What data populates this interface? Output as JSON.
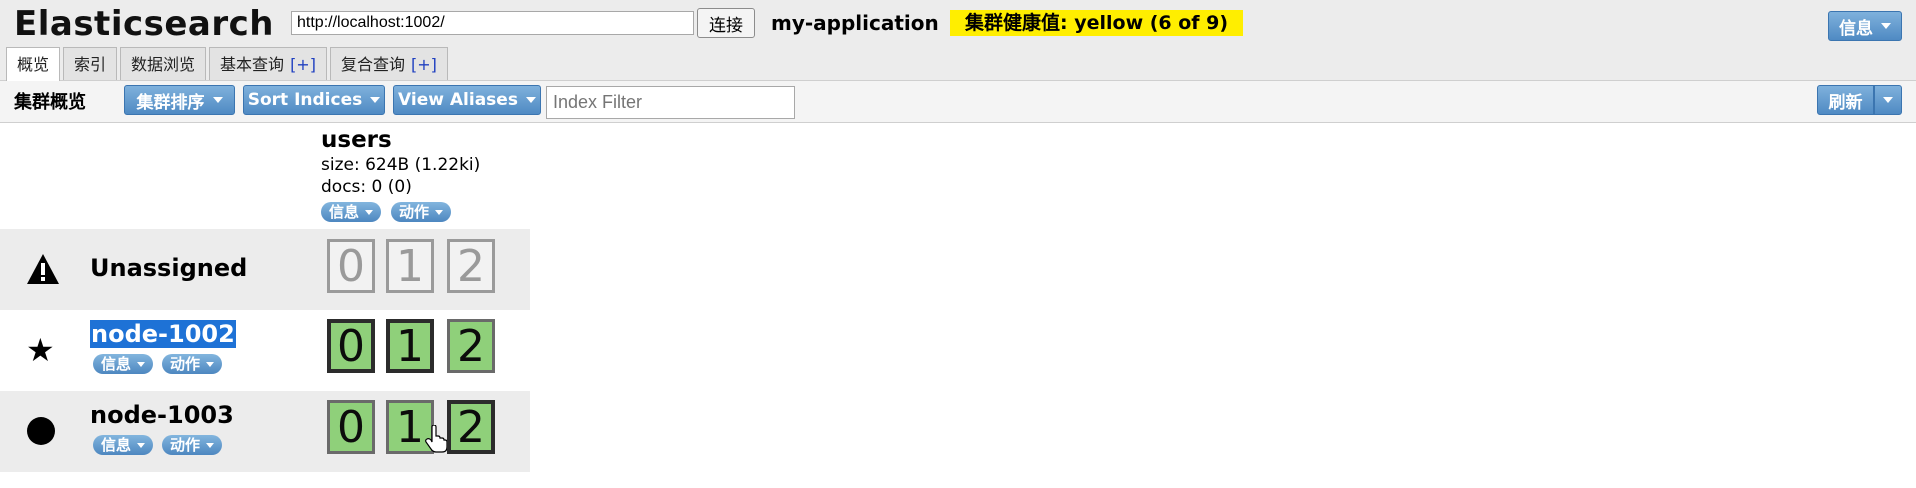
{
  "header": {
    "brand": "Elasticsearch",
    "url": "http://localhost:1002/",
    "connect_label": "连接",
    "cluster_name": "my-application",
    "health": "集群健康值: yellow (6 of 9)",
    "health_color": "#ffee00",
    "info_label": "信息"
  },
  "tabs": [
    {
      "label": "概览",
      "active": true
    },
    {
      "label": "索引",
      "active": false
    },
    {
      "label": "数据浏览",
      "active": false
    },
    {
      "label": "基本查询",
      "plus": "[+]"
    },
    {
      "label": "复合查询",
      "plus": "[+]"
    }
  ],
  "toolbar": {
    "title": "集群概览",
    "sort_cluster": "集群排序",
    "sort_indices": "Sort Indices",
    "view_aliases": "View Aliases",
    "filter_placeholder": "Index Filter",
    "refresh": "刷新"
  },
  "index": {
    "name": "users",
    "size": "size: 624B (1.22ki)",
    "docs": "docs: 0 (0)",
    "info": "信息",
    "action": "动作"
  },
  "rows": [
    {
      "name": "Unassigned",
      "icon": "warning-icon",
      "shards": [
        "0",
        "1",
        "2"
      ],
      "state": "unassigned"
    },
    {
      "name": "node-1002",
      "icon": "star-icon",
      "info": "信息",
      "action": "动作",
      "shards": [
        "0",
        "1",
        "2"
      ],
      "state": "started",
      "selected": true
    },
    {
      "name": "node-1003",
      "icon": "circle-icon",
      "info": "信息",
      "action": "动作",
      "shards": [
        "0",
        "1",
        "2"
      ],
      "state": "started"
    }
  ],
  "colors": {
    "accent_blue": "#4f8ac3",
    "shard_started": "#8fd07a",
    "shard_unassigned_border": "#9a9a9a",
    "row_shade": "#ececec"
  }
}
